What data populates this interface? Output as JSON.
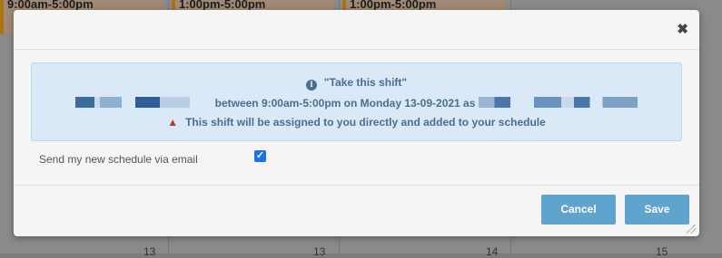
{
  "background": {
    "shifts": [
      "9:00am-5:00pm",
      "1:00pm-5:00pm",
      "1:00pm-5:00pm"
    ],
    "day_numbers": [
      "13",
      "13",
      "14",
      "15"
    ]
  },
  "modal": {
    "close_label": "✖",
    "info": {
      "title": "\"Take this shift\"",
      "shift_text": "between 9:00am-5:00pm on Monday 13-09-2021 as",
      "warning": "This shift will be assigned to you directly and added to your schedule"
    },
    "email_option": {
      "label": "Send my new schedule via email",
      "checked": true
    },
    "buttons": {
      "cancel": "Cancel",
      "save": "Save"
    }
  },
  "colors": {
    "button": "#5ea4cf",
    "info_bg": "#d9e9f7",
    "info_text": "#4a6e8f",
    "warning": "#c0392b"
  }
}
